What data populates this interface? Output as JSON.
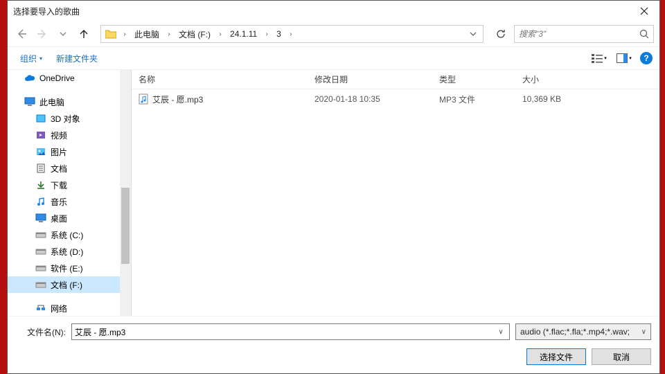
{
  "title": "选择要导入的歌曲",
  "breadcrumb": [
    "此电脑",
    "文档 (F:)",
    "24.1.11",
    "3"
  ],
  "search": {
    "placeholder": "搜索\"3\""
  },
  "cmdbar": {
    "organize": "组织",
    "newfolder": "新建文件夹"
  },
  "tree": {
    "onedrive": "OneDrive",
    "thispc": "此电脑",
    "items": [
      "3D 对象",
      "视频",
      "图片",
      "文档",
      "下载",
      "音乐",
      "桌面",
      "系统 (C:)",
      "系统 (D:)",
      "软件 (E:)",
      "文档 (F:)",
      "网络"
    ],
    "selectedIndex": 10
  },
  "columns": {
    "name": "名称",
    "date": "修改日期",
    "type": "类型",
    "size": "大小"
  },
  "files": [
    {
      "name": "艾辰 - 愿.mp3",
      "date": "2020-01-18 10:35",
      "type": "MP3 文件",
      "size": "10,369 KB"
    }
  ],
  "footer": {
    "filename_label": "文件名(N):",
    "filename_value": "艾辰 - 愿.mp3",
    "filter": "audio (*.flac;*.fla;*.mp4;*.wav;",
    "open": "选择文件",
    "cancel": "取消"
  }
}
